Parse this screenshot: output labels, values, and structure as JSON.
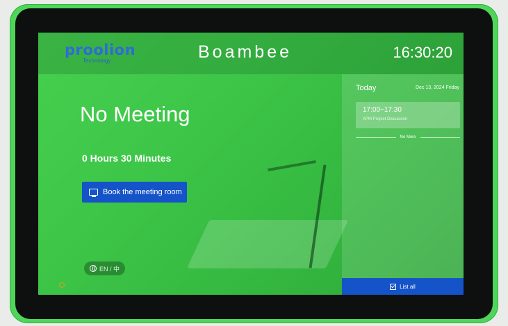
{
  "header": {
    "logo_text": "proolion",
    "logo_subtext": "Technology",
    "room_name": "Boambee",
    "clock": "16:30:20"
  },
  "main": {
    "status": "No Meeting",
    "duration": "0 Hours 30 Minutes",
    "book_button": "Book the meeting room",
    "language": "EN / 中"
  },
  "schedule": {
    "today_label": "Today",
    "date": "Dec 13, 2024  Friday",
    "events": [
      {
        "time": "17:00~17:30",
        "title": "APM Project Discussion"
      }
    ],
    "no_more_label": "No More",
    "list_all_button": "List all"
  },
  "colors": {
    "screen_green": "#3cc447",
    "button_blue": "#1553c8",
    "logo_blue": "#2e6bd8"
  }
}
